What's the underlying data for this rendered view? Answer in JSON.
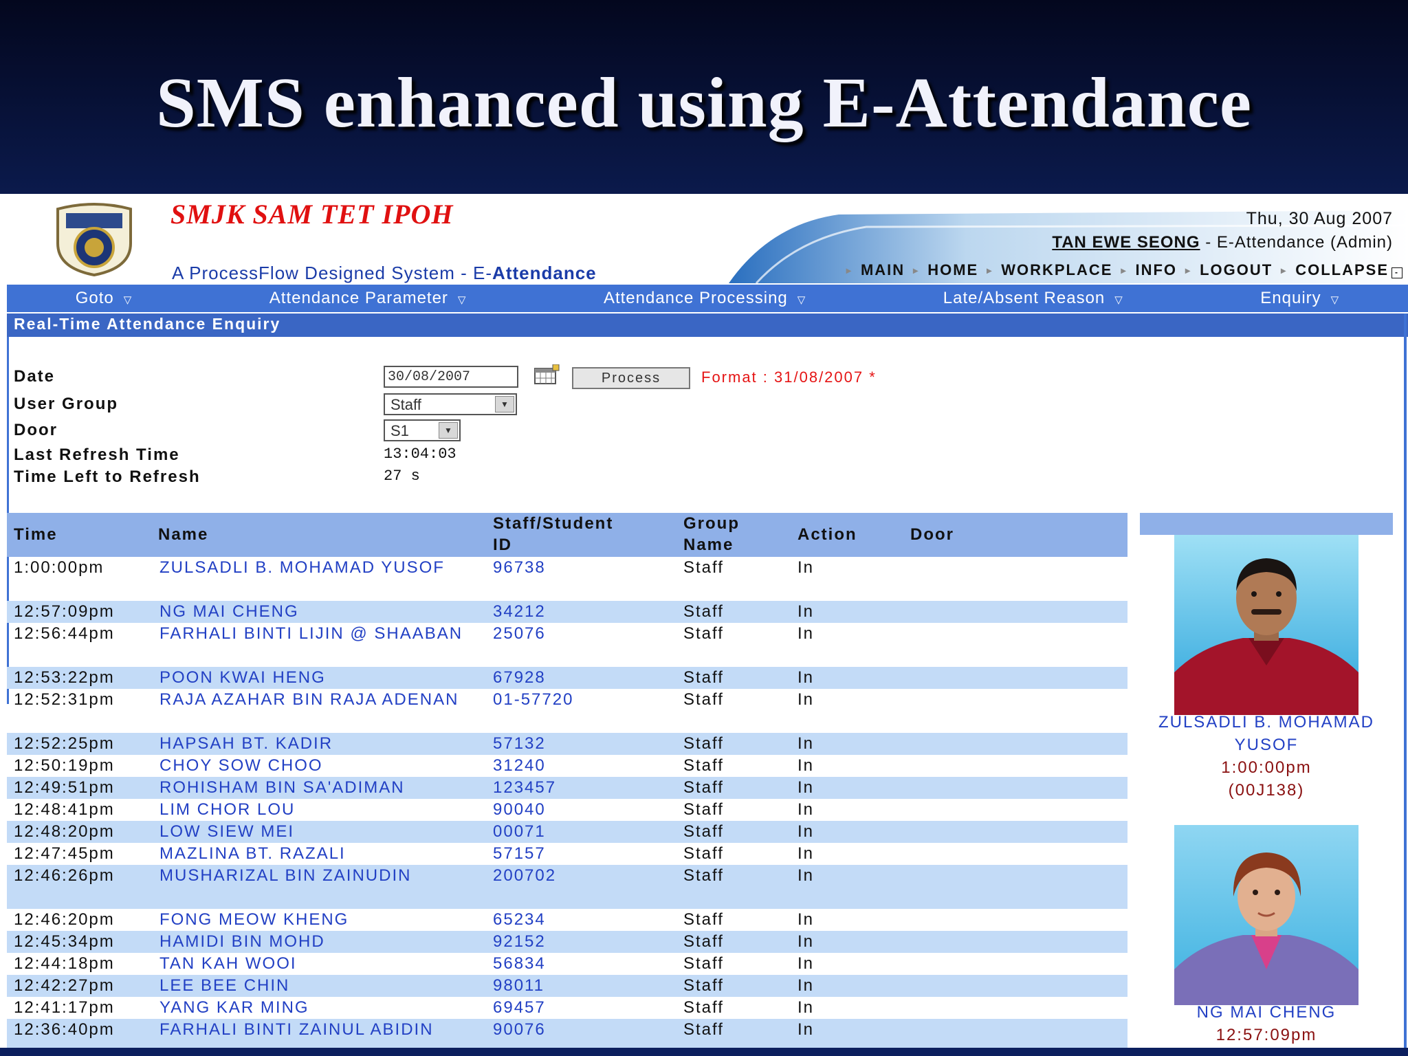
{
  "slide": {
    "title": "SMS enhanced using E-Attendance"
  },
  "app": {
    "school_name": "SMJK SAM TET IPOH",
    "tagline_prefix": "A ProcessFlow Designed System - E-",
    "tagline_bold": "Attendance",
    "date": "Thu, 30 Aug 2007",
    "user_name": "TAN EWE SEONG",
    "user_role": " - E-Attendance (Admin)",
    "top_nav": [
      "MAIN",
      "HOME",
      "WORKPLACE",
      "INFO",
      "LOGOUT",
      "COLLAPSE"
    ],
    "menu": [
      "Goto",
      "Attendance Parameter",
      "Attendance Processing",
      "Late/Absent Reason",
      "Enquiry"
    ]
  },
  "section_title": "Real-Time Attendance Enquiry",
  "form": {
    "date_label": "Date",
    "date_value": "30/08/2007",
    "process_label": "Process",
    "format_text": "Format : 31/08/2007 *",
    "user_group_label": "User Group",
    "user_group_value": "Staff",
    "door_label": "Door",
    "door_value": "S1",
    "last_refresh_label": "Last Refresh Time",
    "last_refresh_value": "13:04:03",
    "time_left_label": "Time Left to Refresh",
    "time_left_value": "27 s"
  },
  "table": {
    "headers": {
      "time": "Time",
      "name": "Name",
      "id_line1": "Staff/Student",
      "id_line2": "ID",
      "group_line1": "Group",
      "group_line2": "Name",
      "action": "Action",
      "door": "Door"
    },
    "rows": [
      {
        "time": "1:00:00pm",
        "name": "ZULSADLI B. MOHAMAD YUSOF",
        "id": "96738",
        "group": "Staff",
        "action": "In"
      },
      {
        "time": "12:57:09pm",
        "name": "NG MAI CHENG",
        "id": "34212",
        "group": "Staff",
        "action": "In"
      },
      {
        "time": "12:56:44pm",
        "name": "FARHALI BINTI LIJIN @ SHAABAN",
        "id": "25076",
        "group": "Staff",
        "action": "In"
      },
      {
        "time": "12:53:22pm",
        "name": "POON KWAI HENG",
        "id": "67928",
        "group": "Staff",
        "action": "In"
      },
      {
        "time": "12:52:31pm",
        "name": "RAJA AZAHAR BIN RAJA ADENAN",
        "id": "01-57720",
        "group": "Staff",
        "action": "In"
      },
      {
        "time": "12:52:25pm",
        "name": "HAPSAH BT. KADIR",
        "id": "57132",
        "group": "Staff",
        "action": "In"
      },
      {
        "time": "12:50:19pm",
        "name": "CHOY SOW CHOO",
        "id": "31240",
        "group": "Staff",
        "action": "In"
      },
      {
        "time": "12:49:51pm",
        "name": "ROHISHAM BIN SA'ADIMAN",
        "id": "123457",
        "group": "Staff",
        "action": "In"
      },
      {
        "time": "12:48:41pm",
        "name": "LIM CHOR LOU",
        "id": "90040",
        "group": "Staff",
        "action": "In"
      },
      {
        "time": "12:48:20pm",
        "name": "LOW SIEW MEI",
        "id": "00071",
        "group": "Staff",
        "action": "In"
      },
      {
        "time": "12:47:45pm",
        "name": "MAZLINA BT. RAZALI",
        "id": "57157",
        "group": "Staff",
        "action": "In"
      },
      {
        "time": "12:46:26pm",
        "name": "MUSHARIZAL BIN ZAINUDIN",
        "id": "200702",
        "group": "Staff",
        "action": "In"
      },
      {
        "time": "12:46:20pm",
        "name": "FONG MEOW KHENG",
        "id": "65234",
        "group": "Staff",
        "action": "In"
      },
      {
        "time": "12:45:34pm",
        "name": "HAMIDI BIN MOHD",
        "id": "92152",
        "group": "Staff",
        "action": "In"
      },
      {
        "time": "12:44:18pm",
        "name": "TAN KAH WOOI",
        "id": "56834",
        "group": "Staff",
        "action": "In"
      },
      {
        "time": "12:42:27pm",
        "name": "LEE BEE CHIN",
        "id": "98011",
        "group": "Staff",
        "action": "In"
      },
      {
        "time": "12:41:17pm",
        "name": "YANG KAR MING",
        "id": "69457",
        "group": "Staff",
        "action": "In"
      },
      {
        "time": "12:36:40pm",
        "name": "FARHALI BINTI ZAINUL ABIDIN",
        "id": "90076",
        "group": "Staff",
        "action": "In"
      }
    ]
  },
  "photos": [
    {
      "name": "ZULSADLI B. MOHAMAD YUSOF",
      "time": "1:00:00pm",
      "code": "(00J138)"
    },
    {
      "name": "NG MAI CHENG",
      "time": "12:57:09pm"
    }
  ]
}
